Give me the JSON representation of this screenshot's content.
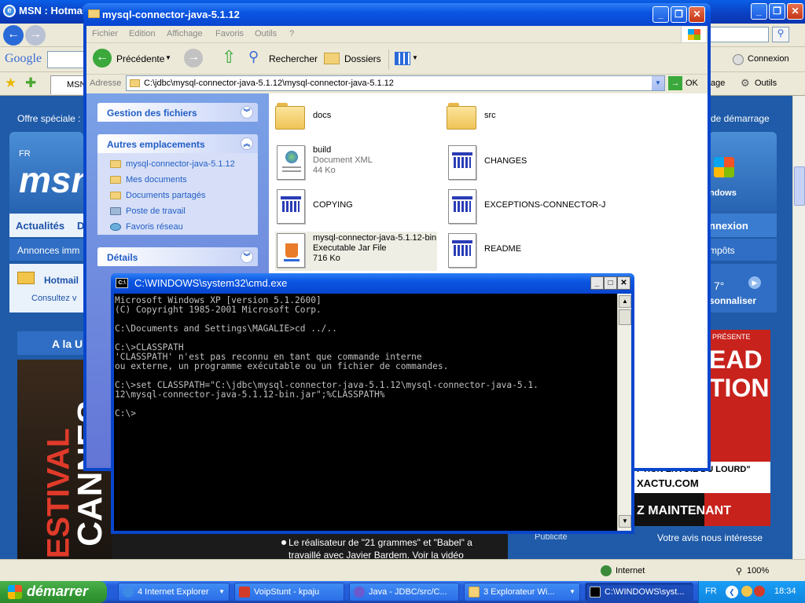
{
  "ie": {
    "title": "MSN : Hotmai",
    "google_label": "Google",
    "connexion": "Connexion",
    "tab_label": "MSN",
    "page_menu": "age",
    "tools_menu": "Outils",
    "offer": "Offre spéciale :",
    "offer_right": "de démarrage",
    "msn_fr": "FR",
    "msn_logo": "msn",
    "nav_actualites": "Actualités",
    "nav_d": "D",
    "nav_connexion": "nnexion",
    "annonces": "Annonces imm",
    "impots": "mpôts",
    "hotmail": "Hotmail",
    "consultez": "Consultez v",
    "windows": "ndows",
    "weather_temp": "7°",
    "personnaliser": "sonnaliser",
    "a_la_une": "A la U",
    "festival": "FESTIVAL",
    "cannes": "CANNES",
    "news_line1": "Le réalisateur de \"21 grammes\" et \"Babel\" a",
    "news_line2": "travaillé avec Javier Bardem. Voir la vidéo",
    "ad_line1": "PRÉSENTE",
    "ad_line2": "EAD",
    "ad_line3": "TION",
    "ad_line4": "PTION ENVOIE DU LOURD\"",
    "ad_line5": "XACTU.COM",
    "ad_line6": "Z MAINTENANT",
    "publicite": "Publicité",
    "votre_avis": "Votre avis nous intéresse",
    "zone": "Internet",
    "zoom": "100%"
  },
  "explorer": {
    "title": "mysql-connector-java-5.1.12",
    "menu": [
      "Fichier",
      "Edition",
      "Affichage",
      "Favoris",
      "Outils",
      "?"
    ],
    "back": "Précédente",
    "search": "Rechercher",
    "folders": "Dossiers",
    "address_label": "Adresse",
    "address": "C:\\jdbc\\mysql-connector-java-5.1.12\\mysql-connector-java-5.1.12",
    "go": "OK",
    "task_files": "Gestion des fichiers",
    "task_other": "Autres emplacements",
    "task_details": "Détails",
    "other_links": [
      "mysql-connector-java-5.1.12",
      "Mes documents",
      "Documents partagés",
      "Poste de travail",
      "Favoris réseau"
    ],
    "files": {
      "docs": "docs",
      "src": "src",
      "build_name": "build",
      "build_type": "Document XML",
      "build_size": "44 Ko",
      "changes": "CHANGES",
      "copying": "COPYING",
      "exceptions": "EXCEPTIONS-CONNECTOR-J",
      "jar_name": "mysql-connector-java-5.1.12-bin",
      "jar_type": "Executable Jar File",
      "jar_size": "716 Ko",
      "readme": "README"
    }
  },
  "cmd": {
    "title": "C:\\WINDOWS\\system32\\cmd.exe",
    "output": "Microsoft Windows XP [version 5.1.2600]\n(C) Copyright 1985-2001 Microsoft Corp.\n\nC:\\Documents and Settings\\MAGALIE>cd ../..\n\nC:\\>CLASSPATH\n'CLASSPATH' n'est pas reconnu en tant que commande interne\nou externe, un programme exécutable ou un fichier de commandes.\n\nC:\\>set CLASSPATH=\"C:\\jdbc\\mysql-connector-java-5.1.12\\mysql-connector-java-5.1.\n12\\mysql-connector-java-5.1.12-bin.jar\";%CLASSPATH%\n\nC:\\>"
  },
  "taskbar": {
    "start": "démarrer",
    "buttons": [
      "4 Internet Explorer",
      "VoipStunt - kpaju",
      "Java - JDBC/src/C...",
      "3 Explorateur Wi...",
      "C:\\WINDOWS\\syst..."
    ],
    "lang": "FR",
    "clock": "18:34"
  }
}
